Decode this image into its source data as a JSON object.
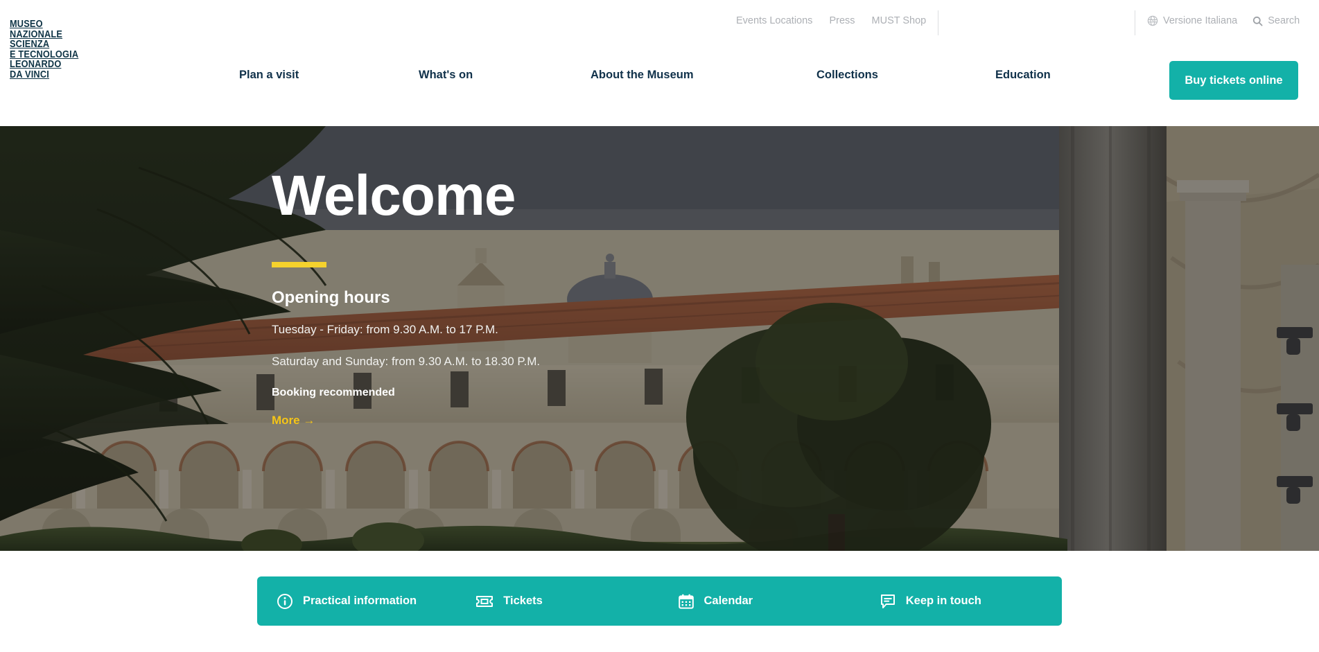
{
  "site": {
    "logo_text": "MUSEO\nNAZIONALE\nSCIENZA\nE TECNOLOGIA\nLEONARDO\nDA VINCI",
    "accent_teal": "#13b1a8",
    "accent_yellow": "#f5d22d",
    "nav_ink": "#10314a"
  },
  "utility": {
    "links": [
      {
        "label": "Events Locations"
      },
      {
        "label": "Press"
      },
      {
        "label": "MUST Shop"
      }
    ],
    "language": {
      "label": "Versione Italiana",
      "icon": "globe-icon"
    },
    "search": {
      "label": "Search",
      "icon": "search-icon"
    }
  },
  "mainnav": {
    "items": [
      {
        "label": "Plan a visit"
      },
      {
        "label": "What's on"
      },
      {
        "label": "About the Museum"
      },
      {
        "label": "Collections"
      },
      {
        "label": "Education"
      }
    ],
    "cta": {
      "label": "Buy tickets online"
    }
  },
  "hero": {
    "title": "Welcome",
    "subtitle": "Opening hours",
    "line1": "Tuesday - Friday: from 9.30 A.M. to 17 P.M.",
    "line2": "Saturday and Sunday: from 9.30 A.M. to 18.30 P.M.",
    "note": "Booking recommended",
    "more_label": "More →"
  },
  "quicklinks": {
    "items": [
      {
        "label": "Practical information",
        "icon": "info-circle-icon"
      },
      {
        "label": "Tickets",
        "icon": "ticket-icon"
      },
      {
        "label": "Calendar",
        "icon": "calendar-icon"
      },
      {
        "label": "Keep in touch",
        "icon": "speech-bubble-icon"
      }
    ]
  }
}
